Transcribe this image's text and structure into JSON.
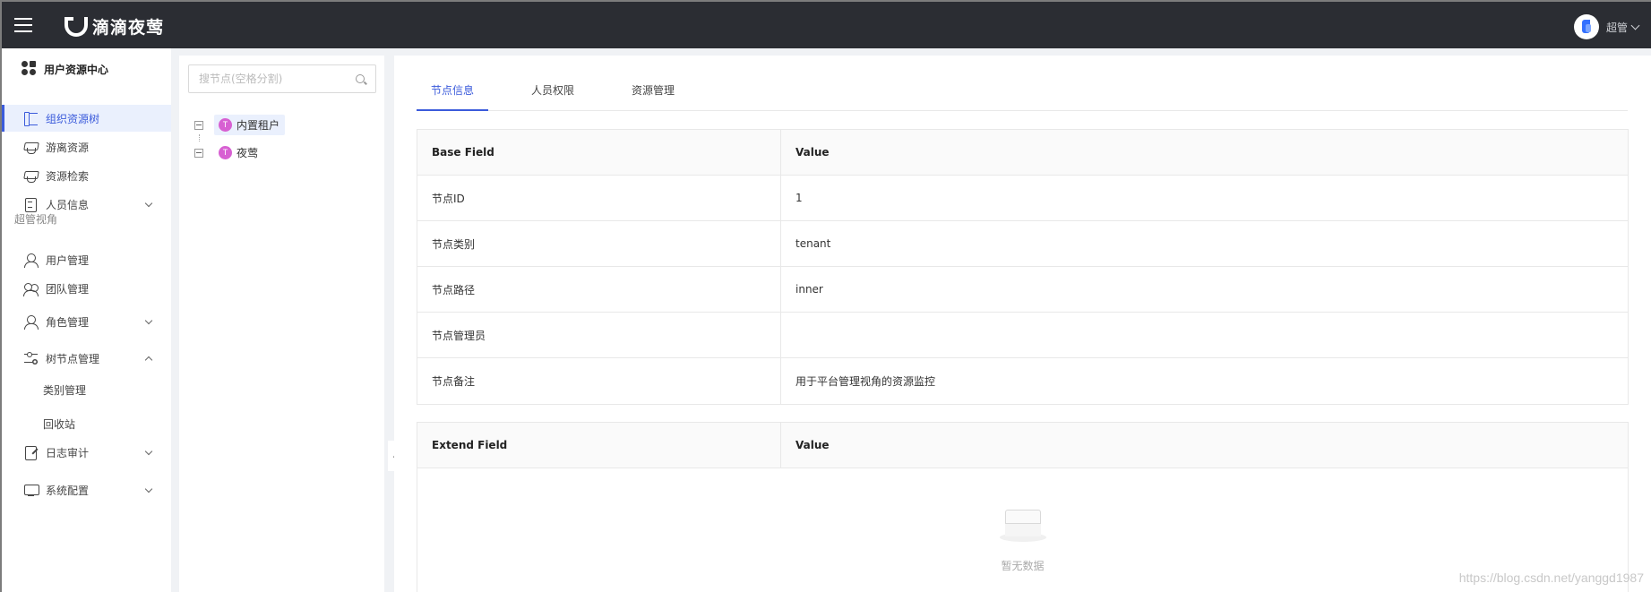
{
  "app": {
    "brand": "滴滴夜莺"
  },
  "header": {
    "user_name": "超管"
  },
  "sidebar": {
    "title": "用户资源中心",
    "items": [
      {
        "label": "组织资源树",
        "icon": "tree-icon",
        "active": true
      },
      {
        "label": "游离资源",
        "icon": "cap-icon"
      },
      {
        "label": "资源检索",
        "icon": "cap-search-icon"
      },
      {
        "label": "人员信息",
        "icon": "doc-icon",
        "expandable": true
      }
    ],
    "section_label": "超管视角",
    "admin_items": [
      {
        "label": "用户管理",
        "icon": "person-icon"
      },
      {
        "label": "团队管理",
        "icon": "team-icon"
      },
      {
        "label": "角色管理",
        "icon": "person-edit-icon",
        "expandable": true
      },
      {
        "label": "树节点管理",
        "icon": "sliders-icon",
        "expanded": true
      },
      {
        "label": "类别管理"
      },
      {
        "label": "回收站"
      },
      {
        "label": "日志审计",
        "icon": "edit-icon",
        "expandable": true
      },
      {
        "label": "系统配置",
        "icon": "monitor-icon",
        "expandable": true
      }
    ]
  },
  "tree": {
    "search_placeholder": "搜节点(空格分割)",
    "nodes": [
      {
        "badge": "T",
        "label": "内置租户",
        "selected": true
      },
      {
        "badge": "T",
        "label": "夜莺"
      }
    ]
  },
  "collapse": {
    "glyph": "〈"
  },
  "tabs": [
    "节点信息",
    "人员权限",
    "资源管理"
  ],
  "base_table": {
    "headers": [
      "Base Field",
      "Value"
    ],
    "rows": [
      [
        "节点ID",
        "1"
      ],
      [
        "节点类别",
        "tenant"
      ],
      [
        "节点路径",
        "inner"
      ],
      [
        "节点管理员",
        ""
      ],
      [
        "节点备注",
        "用于平台管理视角的资源监控"
      ]
    ]
  },
  "extend_table": {
    "headers": [
      "Extend Field",
      "Value"
    ],
    "empty_text": "暂无数据"
  },
  "watermark": "https://blog.csdn.net/yanggd1987",
  "colors": {
    "accent": "#3b5bdb",
    "header_bg": "#2b2d33",
    "badge": "#d760d2"
  }
}
